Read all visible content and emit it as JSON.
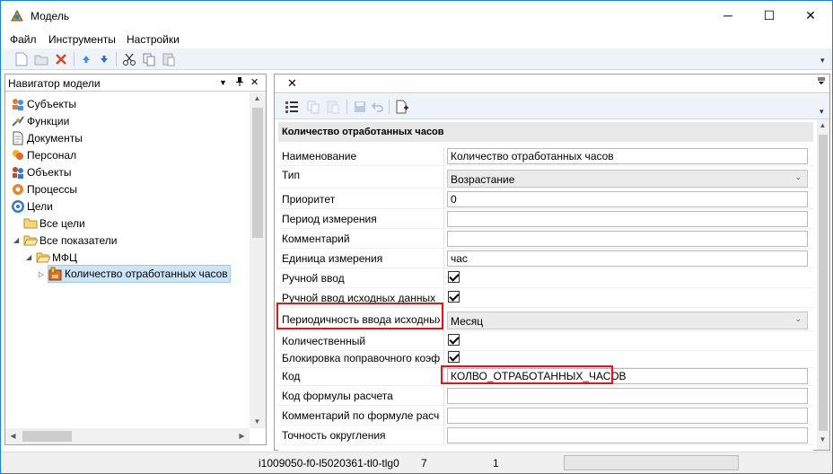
{
  "window": {
    "title": "Модель",
    "minimize": "─",
    "maximize": "☐",
    "close": "✕"
  },
  "menu": {
    "items": [
      "Файл",
      "Инструменты",
      "Настройки"
    ]
  },
  "toolbar": {
    "icons": [
      "new-document-icon",
      "open-folder-icon",
      "delete-icon",
      "move-up-icon",
      "move-down-icon",
      "cut-icon",
      "copy-icon",
      "paste-icon"
    ]
  },
  "navigator": {
    "title": "Навигатор модели",
    "pin": "📌",
    "close": "✕",
    "items": [
      {
        "label": "Субъекты",
        "icon": "subjects-icon"
      },
      {
        "label": "Функции",
        "icon": "functions-icon"
      },
      {
        "label": "Документы",
        "icon": "documents-icon"
      },
      {
        "label": "Персонал",
        "icon": "personnel-icon"
      },
      {
        "label": "Объекты",
        "icon": "objects-icon"
      },
      {
        "label": "Процессы",
        "icon": "processes-icon"
      },
      {
        "label": "Цели",
        "icon": "goals-icon"
      },
      {
        "label": "Все цели",
        "icon": "folder-icon"
      },
      {
        "label": "Все показатели",
        "icon": "folder-open-icon"
      },
      {
        "label": "МФЦ",
        "icon": "folder-open-icon"
      },
      {
        "label": "Количество отработанных часов",
        "icon": "indicator-icon"
      }
    ]
  },
  "editor": {
    "tab_close": "✕",
    "category": "Количество отработанных часов",
    "properties": [
      {
        "name": "Наименование",
        "value": "Количество отработанных часов",
        "kind": "text"
      },
      {
        "name": "Тип",
        "value": "Возрастание",
        "kind": "combo"
      },
      {
        "name": "Приоритет",
        "value": "0",
        "kind": "text"
      },
      {
        "name": "Период измерения",
        "value": "",
        "kind": "text"
      },
      {
        "name": "Комментарий",
        "value": "",
        "kind": "text"
      },
      {
        "name": "Единица измерения",
        "value": "час",
        "kind": "text"
      },
      {
        "name": "Ручной ввод",
        "value": "true",
        "kind": "check"
      },
      {
        "name": "Ручной ввод исходных данных",
        "value": "true",
        "kind": "check"
      },
      {
        "name": "Периодичность ввода исходных",
        "value": "Месяц",
        "kind": "combo"
      },
      {
        "name": "Количественный",
        "value": "true",
        "kind": "check"
      },
      {
        "name": "Блокировка поправочного коэф",
        "value": "true",
        "kind": "check"
      },
      {
        "name": "Код",
        "value": "КОЛВО_ОТРАБОТАННЫХ_ЧАСОВ",
        "kind": "text"
      },
      {
        "name": "Код формулы расчета",
        "value": "",
        "kind": "text"
      },
      {
        "name": "Комментарий по формуле расче",
        "value": "",
        "kind": "text"
      },
      {
        "name": "Точность округления",
        "value": "",
        "kind": "text"
      }
    ]
  },
  "status": {
    "id": "i1009050-f0-l5020361-tl0-tlg0",
    "value1": "7",
    "value2": "1"
  },
  "colors": {
    "highlight": "#e0151b",
    "selection": "#cce4f7",
    "toolbar_bg": "#eef3fa"
  }
}
